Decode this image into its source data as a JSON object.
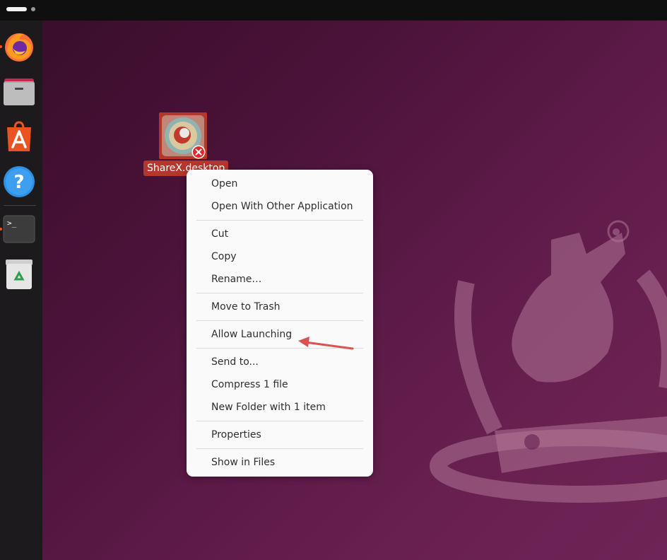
{
  "topbar": {
    "workspace_indicator": "workspace-indicator"
  },
  "dock": {
    "items": [
      {
        "name": "firefox-icon",
        "running": true
      },
      {
        "name": "files-icon",
        "running": false
      },
      {
        "name": "app-center-icon",
        "running": false
      },
      {
        "name": "help-icon",
        "running": false
      },
      {
        "name": "terminal-icon",
        "running": true
      },
      {
        "name": "trash-icon",
        "running": false
      }
    ]
  },
  "desktop": {
    "file_icon": {
      "label": "ShareX.desktop",
      "icon": "sharex-icon",
      "badge": "untrusted-badge-icon"
    }
  },
  "context_menu": {
    "items": [
      {
        "label": "Open"
      },
      {
        "label": "Open With Other Application"
      },
      {
        "label": "Cut"
      },
      {
        "label": "Copy"
      },
      {
        "label": "Rename…"
      },
      {
        "label": "Move to Trash"
      },
      {
        "label": "Allow Launching"
      },
      {
        "label": "Send to..."
      },
      {
        "label": "Compress 1 file"
      },
      {
        "label": "New Folder with 1 item"
      },
      {
        "label": "Properties"
      },
      {
        "label": "Show in Files"
      }
    ]
  },
  "annotation": {
    "icon": "red-arrow-icon",
    "color": "#d9534f"
  },
  "colors": {
    "accent": "#e95420",
    "selection": "#b5362c"
  }
}
